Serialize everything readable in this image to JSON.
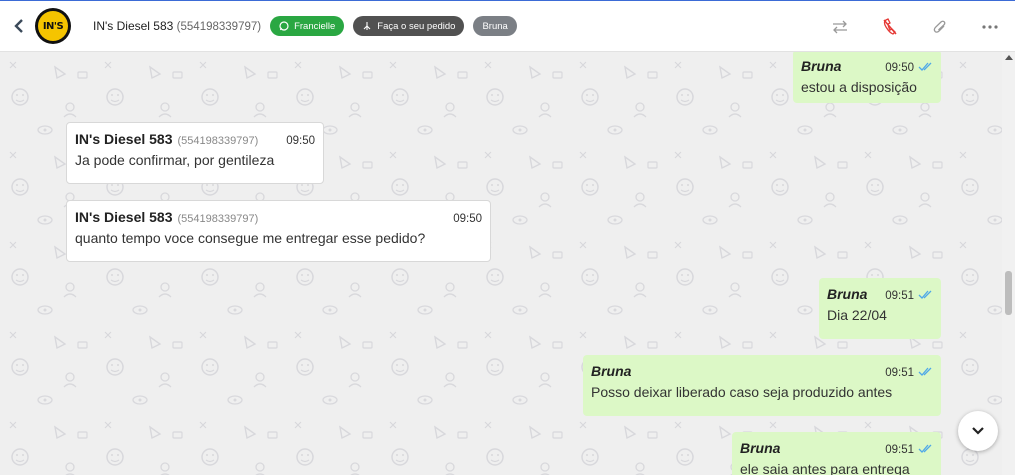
{
  "header": {
    "avatar_text": "IN'S",
    "contact_name": "IN's Diesel 583",
    "contact_phone": "(554198339797)",
    "chips": [
      {
        "label": "Francielle",
        "icon": "whatsapp-icon",
        "color": "#2aa742"
      },
      {
        "label": "Faça o seu pedido",
        "icon": "flow-icon",
        "color": "#515151"
      },
      {
        "label": "Bruna",
        "icon": "",
        "color": "#7b7f85"
      }
    ],
    "actions": [
      "transfer-icon",
      "end-call-icon",
      "attach-icon",
      "more-icon"
    ]
  },
  "messages": [
    {
      "direction": "out",
      "author": "Bruna",
      "time": "09:50",
      "text": "estou a disposição",
      "read": true
    },
    {
      "direction": "in",
      "author": "IN's Diesel 583",
      "phone": "(554198339797)",
      "time": "09:50",
      "text": "Ja pode confirmar, por gentileza"
    },
    {
      "direction": "in",
      "author": "IN's Diesel 583",
      "phone": "(554198339797)",
      "time": "09:50",
      "text": "quanto tempo voce consegue me entregar esse pedido?"
    },
    {
      "direction": "out",
      "author": "Bruna",
      "time": "09:51",
      "text": "Dia 22/04",
      "read": true
    },
    {
      "direction": "out",
      "author": "Bruna",
      "time": "09:51",
      "text": "Posso deixar liberado caso seja produzido antes",
      "read": true
    },
    {
      "direction": "out",
      "author": "Bruna",
      "time": "09:51",
      "text": "ele saia antes para entrega",
      "read": true
    }
  ],
  "colors": {
    "accent": "#3b6bd6",
    "outgoing_bubble": "#dcf8c6",
    "read_ticks": "#4fa8e8",
    "end_call": "#e53935"
  }
}
